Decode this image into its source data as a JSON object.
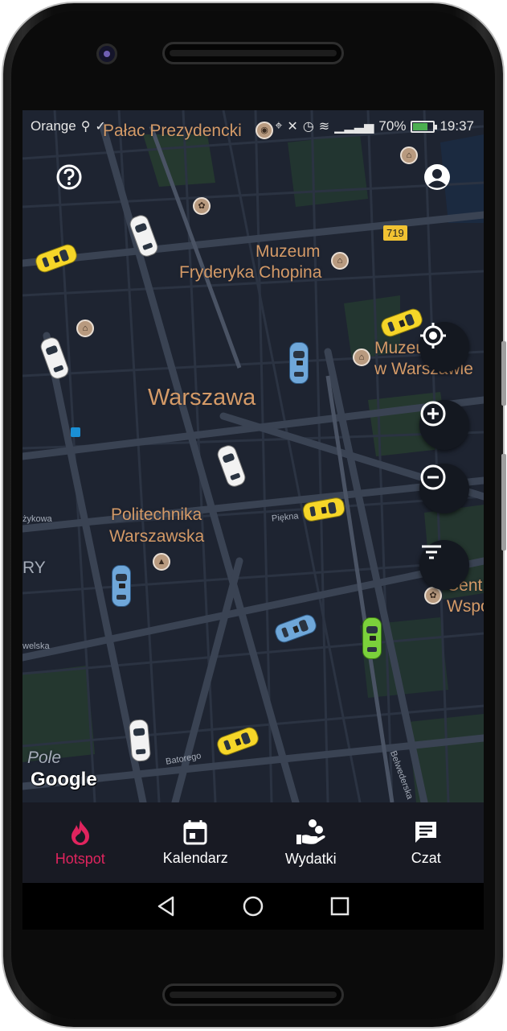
{
  "status_bar": {
    "carrier": "Orange",
    "battery": "70%",
    "time": "19:37"
  },
  "map": {
    "labels": {
      "palace": "Pałac Prezydencki",
      "museum_chopin_line1": "Muzeum",
      "museum_chopin_line2": "Fryderyka Chopina",
      "museum_partial_line1": "Muzeum ...",
      "museum_partial_line2": "w Warszawie",
      "city": "Warszawa",
      "poli_line1": "Politechnika",
      "poli_line2": "Warszawska",
      "left_partial": "RY",
      "right_partial_line1": "Cent",
      "right_partial_line2": "Wspo",
      "pole": "Pole"
    },
    "streets": {
      "piekna": "Piękna",
      "zykowa": "żykowa",
      "welska": "welska",
      "batorego": "Batorego",
      "belwederska": "Belwederska"
    },
    "road_sign": "719",
    "attribution": "Google"
  },
  "controls": {
    "help_icon": "help-circle-icon",
    "account_icon": "account-circle-icon",
    "locate_icon": "crosshair-icon",
    "zoom_in_icon": "plus-circle-icon",
    "zoom_out_icon": "minus-circle-icon",
    "filter_icon": "filter-icon"
  },
  "bottom_nav": {
    "items": [
      {
        "label": "Hotspot",
        "icon": "flame-icon",
        "active": true
      },
      {
        "label": "Kalendarz",
        "icon": "calendar-icon",
        "active": false
      },
      {
        "label": "Wydatki",
        "icon": "hand-coins-icon",
        "active": false
      },
      {
        "label": "Czat",
        "icon": "chat-icon",
        "active": false
      }
    ]
  },
  "colors": {
    "active": "#e0245e",
    "map_background": "#1d2330",
    "nav_background": "#181a23",
    "label": "#d49a67"
  }
}
